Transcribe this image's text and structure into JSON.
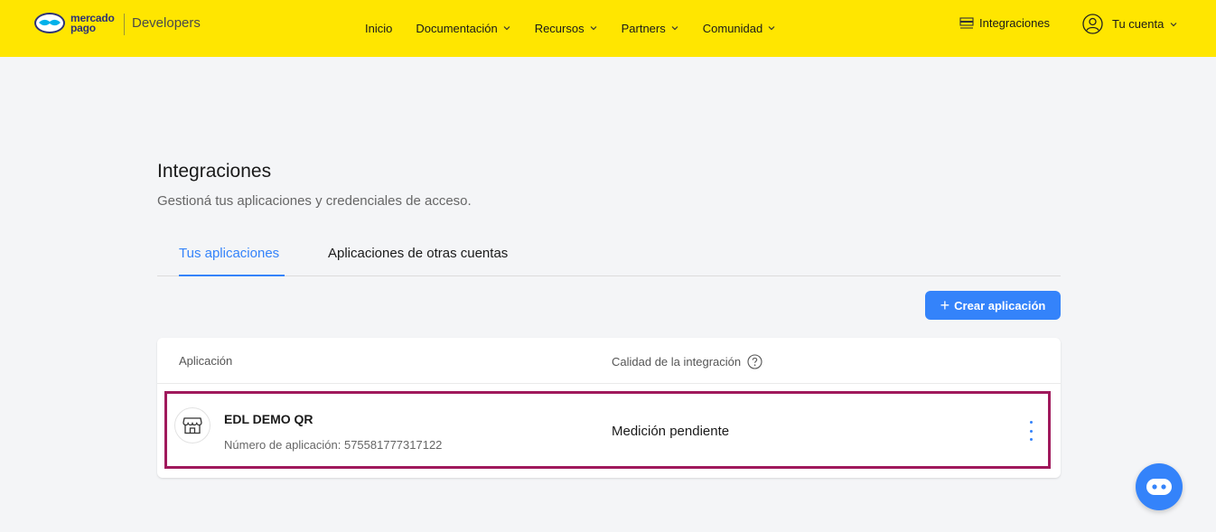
{
  "header": {
    "logo_text_line1": "mercado",
    "logo_text_line2": "pago",
    "developers_label": "Developers",
    "nav": [
      {
        "label": "Inicio",
        "has_dropdown": false
      },
      {
        "label": "Documentación",
        "has_dropdown": true
      },
      {
        "label": "Recursos",
        "has_dropdown": true
      },
      {
        "label": "Partners",
        "has_dropdown": true
      },
      {
        "label": "Comunidad",
        "has_dropdown": true
      }
    ],
    "integrations_label": "Integraciones",
    "account_label": "Tu cuenta"
  },
  "page": {
    "title": "Integraciones",
    "subtitle": "Gestioná tus aplicaciones y credenciales de acceso."
  },
  "tabs": {
    "active": "Tus aplicaciones",
    "other": "Aplicaciones de otras cuentas"
  },
  "create_button": {
    "label": "Crear aplicación"
  },
  "table": {
    "col_app": "Aplicación",
    "col_quality": "Calidad de la integración",
    "rows": [
      {
        "name": "EDL DEMO QR",
        "number_text": "Número de aplicación: 575581777317122",
        "quality": "Medición pendiente"
      }
    ]
  },
  "colors": {
    "header_bg": "#ffe600",
    "accent": "#3483fa",
    "highlight_border": "#a0195c",
    "page_bg": "#f4f5f7"
  },
  "icons": {
    "logo": "handshake-logo-icon",
    "integrations": "list-icon",
    "account": "user-circle-icon",
    "help": "question-circle-icon",
    "app": "store-icon",
    "menu": "kebab-icon",
    "chat": "chatbot-icon"
  }
}
